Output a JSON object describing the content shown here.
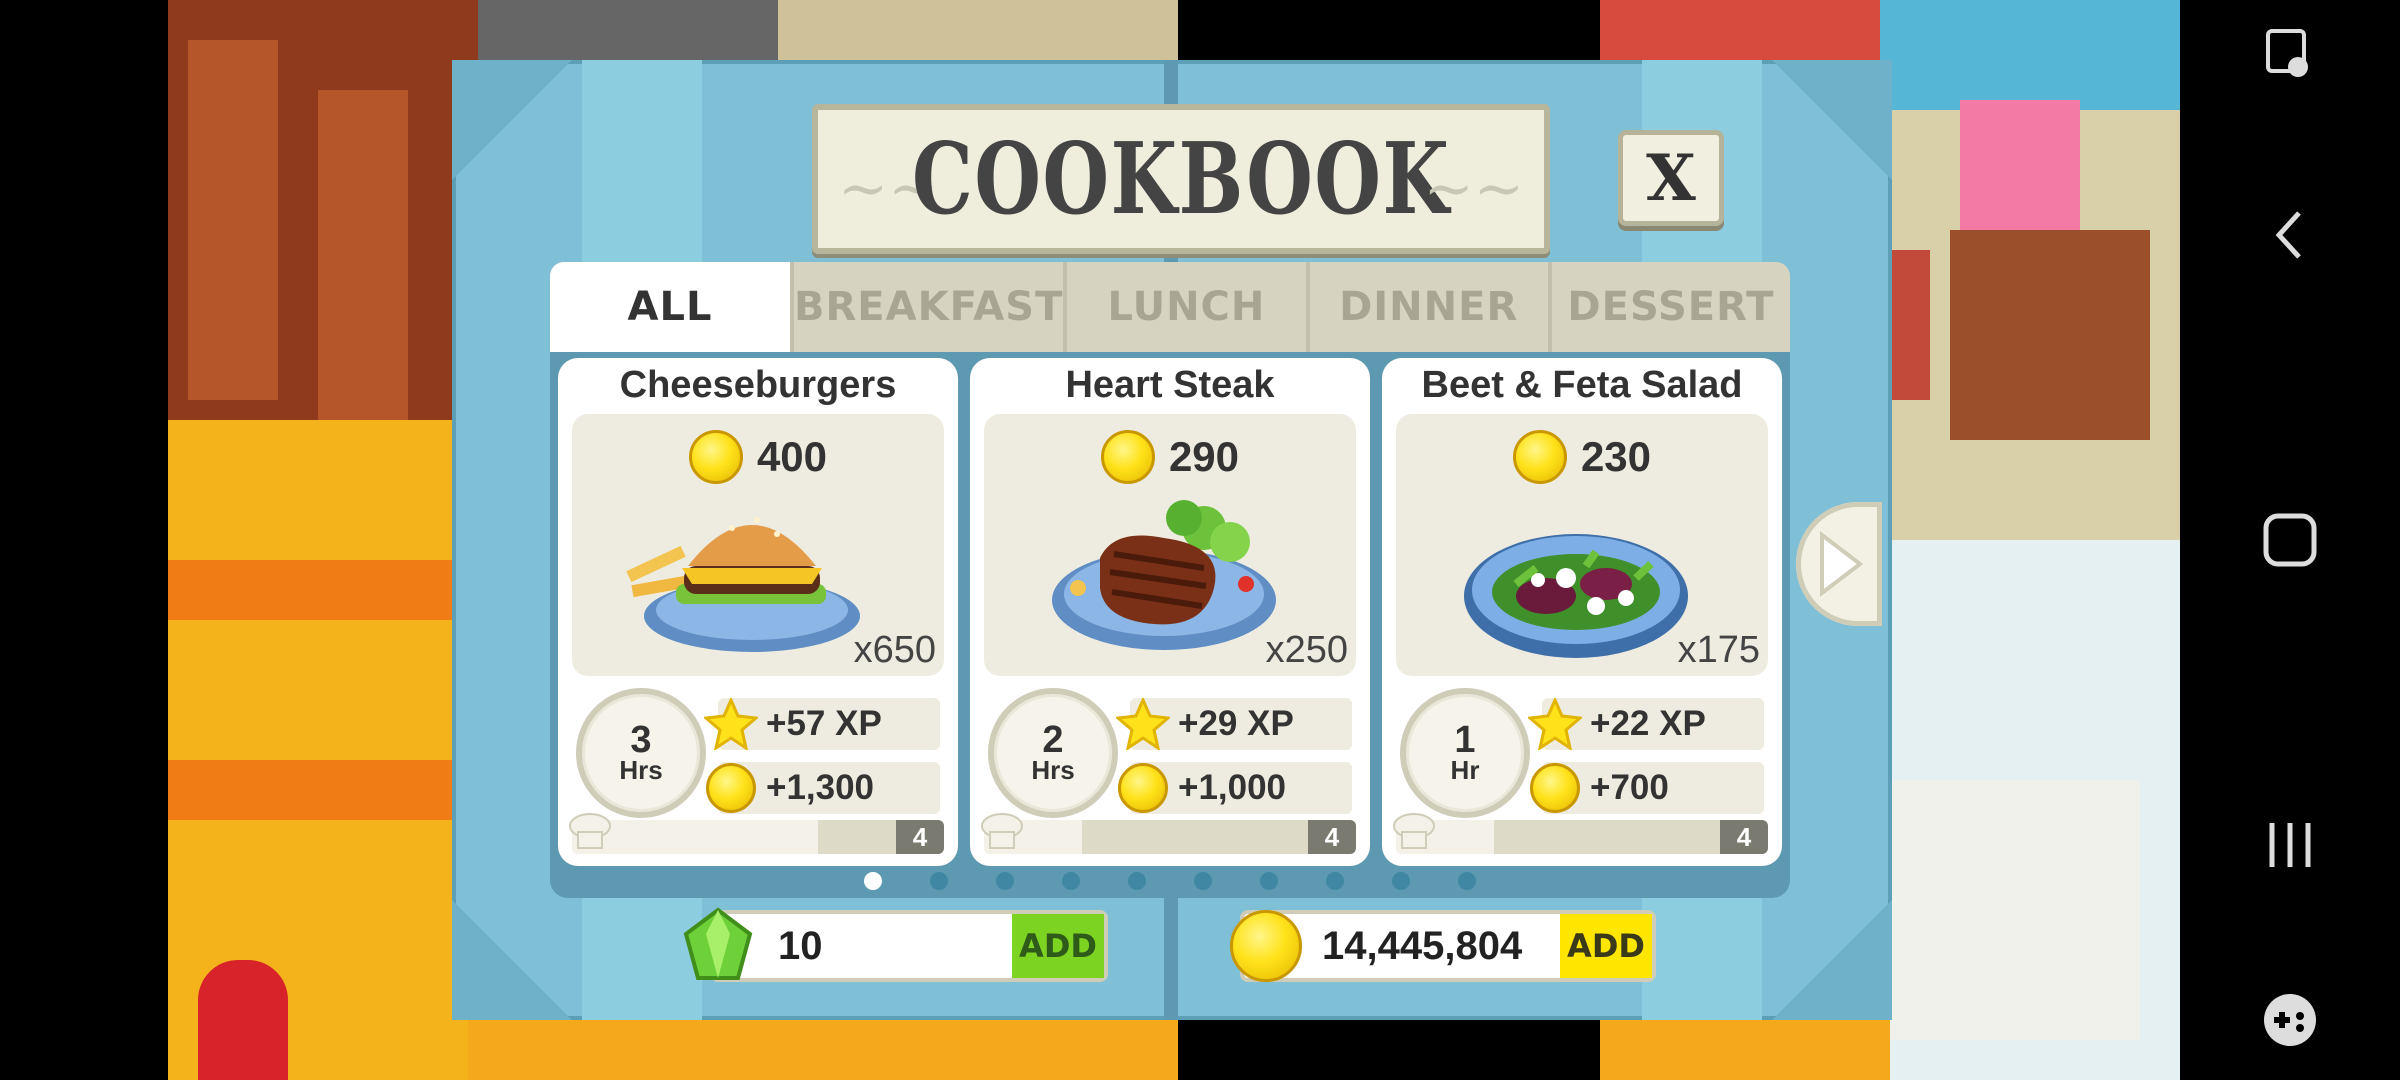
{
  "title": "COOKBOOK",
  "close_label": "X",
  "tabs": [
    {
      "label": "ALL",
      "active": true
    },
    {
      "label": "BREAKFAST",
      "active": false
    },
    {
      "label": "LUNCH",
      "active": false
    },
    {
      "label": "DINNER",
      "active": false
    },
    {
      "label": "DESSERT",
      "active": false
    }
  ],
  "recipes": [
    {
      "name": "Cheeseburgers",
      "price": "400",
      "yield": "x650",
      "time_num": "3",
      "time_unit": "Hrs",
      "xp": "+57 XP",
      "coins": "+1,300",
      "mastery_level": "4",
      "mastery_progress": 0.75,
      "dish_icon": "cheeseburger-icon"
    },
    {
      "name": "Heart Steak",
      "price": "290",
      "yield": "x250",
      "time_num": "2",
      "time_unit": "Hrs",
      "xp": "+29 XP",
      "coins": "+1,000",
      "mastery_level": "4",
      "mastery_progress": 0.3,
      "dish_icon": "steak-icon"
    },
    {
      "name": "Beet & Feta Salad",
      "price": "230",
      "yield": "x175",
      "time_num": "1",
      "time_unit": "Hr",
      "xp": "+22 XP",
      "coins": "+700",
      "mastery_level": "4",
      "mastery_progress": 0.3,
      "dish_icon": "salad-icon"
    }
  ],
  "pagination": {
    "total": 10,
    "current": 1
  },
  "currency": {
    "gems": "10",
    "coins": "14,445,804",
    "add_label": "ADD"
  },
  "colors": {
    "panel": "#7fc0d6",
    "gem_add": "#7dd321",
    "coin_add": "#ffe600"
  }
}
